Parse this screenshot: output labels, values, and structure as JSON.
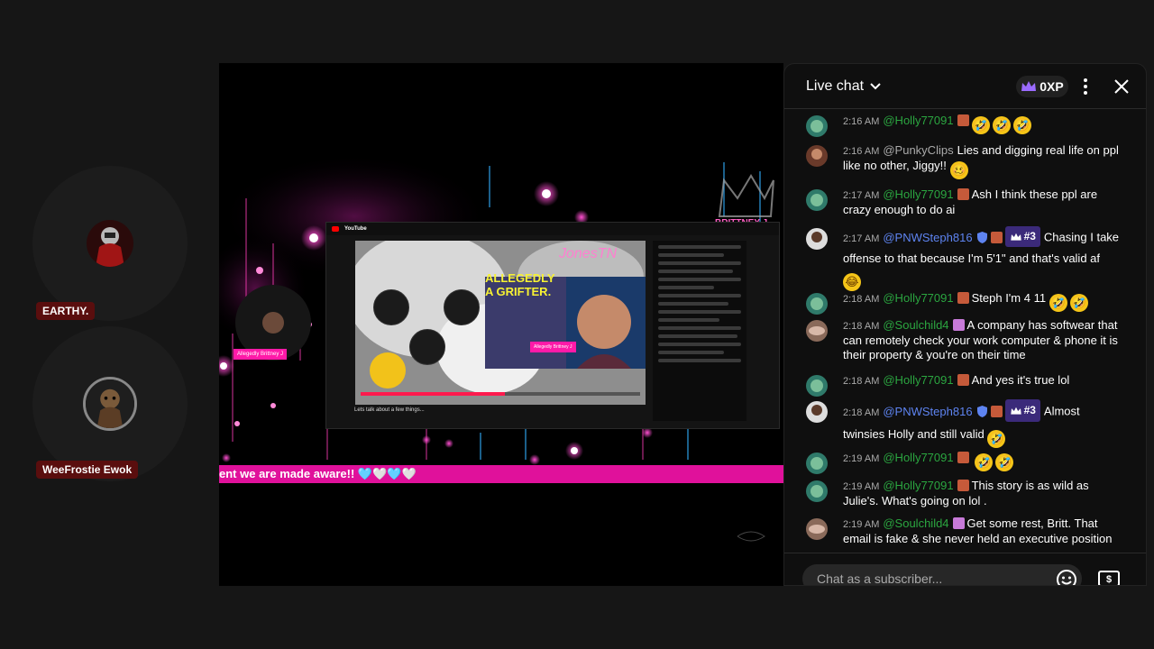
{
  "participants": [
    {
      "name": "EARTHY.",
      "avatar_icon": "red-armored-figure-avatar"
    },
    {
      "name": "WeeFrostie Ewok",
      "avatar_icon": "ewok-avatar"
    }
  ],
  "stage": {
    "ticker_text": "ent we are made aware!! 🩵🤍🩵🤍",
    "overlay_brand": "BRITTNEY J",
    "inner_headline_1": "ALLEGEDLY",
    "inner_headline_2": "A GRIFTER.",
    "inner_title": "Lets talk about a few things...",
    "inner_signature": "JonesTN",
    "guest_label": "Allegedly Brittney J",
    "inner_label": "Allegedly Brittney J"
  },
  "chat": {
    "title": "Live chat",
    "xp": "0XP",
    "input_placeholder": "Chat as a subscriber...",
    "messages": [
      {
        "time": "2:16 AM",
        "author": "@Holly77091",
        "author_color": "green",
        "text": "",
        "emojis": [
          "🤣",
          "🤣",
          "🤣"
        ]
      },
      {
        "time": "2:16 AM",
        "author": "@PunkyClips",
        "author_color": "gray",
        "text": "Lies and digging real life on ppl like no other, Jiggy!!",
        "emojis": [
          "🥴"
        ]
      },
      {
        "time": "2:17 AM",
        "author": "@Holly77091",
        "author_color": "green",
        "text": "Ash I think these ppl are crazy enough to do ai",
        "emojis": []
      },
      {
        "time": "2:17 AM",
        "author": "@PNWSteph816",
        "author_color": "blue",
        "rank": "#3",
        "text": "Chasing I take offense to that because I'm 5'1\" and that's valid af",
        "emojis": [
          "😂"
        ]
      },
      {
        "time": "2:18 AM",
        "author": "@Holly77091",
        "author_color": "green",
        "text": "Steph I'm 4 11",
        "emojis": [
          "🤣",
          "🤣"
        ]
      },
      {
        "time": "2:18 AM",
        "author": "@Soulchild4",
        "author_color": "green",
        "text": "A company has softwear that can remotely check your work computer & phone it is their property & you're on their time",
        "emojis": []
      },
      {
        "time": "2:18 AM",
        "author": "@Holly77091",
        "author_color": "green",
        "text": "And yes it's true lol",
        "emojis": []
      },
      {
        "time": "2:18 AM",
        "author": "@PNWSteph816",
        "author_color": "blue",
        "rank": "#3",
        "text": "Almost twinsies Holly and still valid",
        "emojis": [
          "🤣"
        ]
      },
      {
        "time": "2:19 AM",
        "author": "@Holly77091",
        "author_color": "green",
        "text": "",
        "emojis": [
          "🤣",
          "🤣"
        ]
      },
      {
        "time": "2:19 AM",
        "author": "@Holly77091",
        "author_color": "green",
        "text": "This story is as wild as Julie's. What's going on lol .",
        "emojis": []
      },
      {
        "time": "2:19 AM",
        "author": "@Soulchild4",
        "author_color": "green",
        "text": "Get some rest, Britt. That email is fake & she never held an executive position",
        "emojis": []
      }
    ]
  },
  "colors": {
    "accent_pink": "#e0119b",
    "member_green": "#2ba640",
    "moderator_blue": "#5e84f1",
    "name_tag_bg": "#5a0e0e"
  }
}
